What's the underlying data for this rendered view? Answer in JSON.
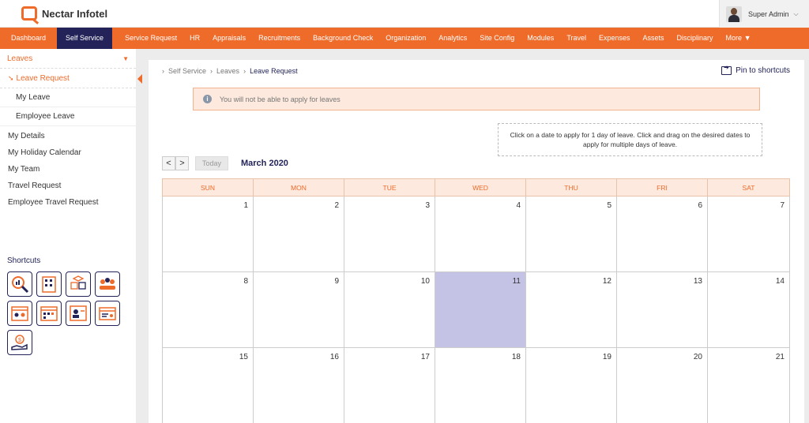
{
  "brand": {
    "name": "Nectar Infotel"
  },
  "user": {
    "name": "Super Admin"
  },
  "nav": {
    "items": [
      "Dashboard",
      "Self Service",
      "Service Request",
      "HR",
      "Appraisals",
      "Recruitments",
      "Background Check",
      "Organization",
      "Analytics",
      "Site Config",
      "Modules",
      "Travel",
      "Expenses",
      "Assets",
      "Disciplinary"
    ],
    "more": "More"
  },
  "sidebar": {
    "header": "Leaves",
    "active": "Leave Request",
    "sub": [
      "My Leave",
      "Employee Leave"
    ],
    "items": [
      "My Details",
      "My Holiday Calendar",
      "My Team",
      "Travel Request",
      "Employee Travel Request"
    ],
    "shortcuts_title": "Shortcuts",
    "shortcut_icons": [
      "search-report-icon",
      "building-icon",
      "boxes-icon",
      "team-icon",
      "calendar-team-icon",
      "calendar-grid-icon",
      "profile-card-icon",
      "id-card-icon",
      "money-hand-icon"
    ]
  },
  "breadcrumb": [
    "Self Service",
    "Leaves",
    "Leave Request"
  ],
  "pin_label": "Pin to shortcuts",
  "alert": "You will not be able to apply for leaves",
  "hint": "Click on a date to apply for 1 day of leave. Click and drag on the desired dates to apply for multiple days of leave.",
  "calendar": {
    "prev": "<",
    "next": ">",
    "today_label": "Today",
    "month": "March 2020",
    "weekdays": [
      "SUN",
      "MON",
      "TUE",
      "WED",
      "THU",
      "FRI",
      "SAT"
    ],
    "weeks": [
      [
        "1",
        "2",
        "3",
        "4",
        "5",
        "6",
        "7"
      ],
      [
        "8",
        "9",
        "10",
        "11",
        "12",
        "13",
        "14"
      ],
      [
        "15",
        "16",
        "17",
        "18",
        "19",
        "20",
        "21"
      ]
    ],
    "highlight": "11"
  },
  "colors": {
    "accent": "#ef6b2a",
    "navy": "#23235a",
    "today": "#c4c3e6"
  }
}
